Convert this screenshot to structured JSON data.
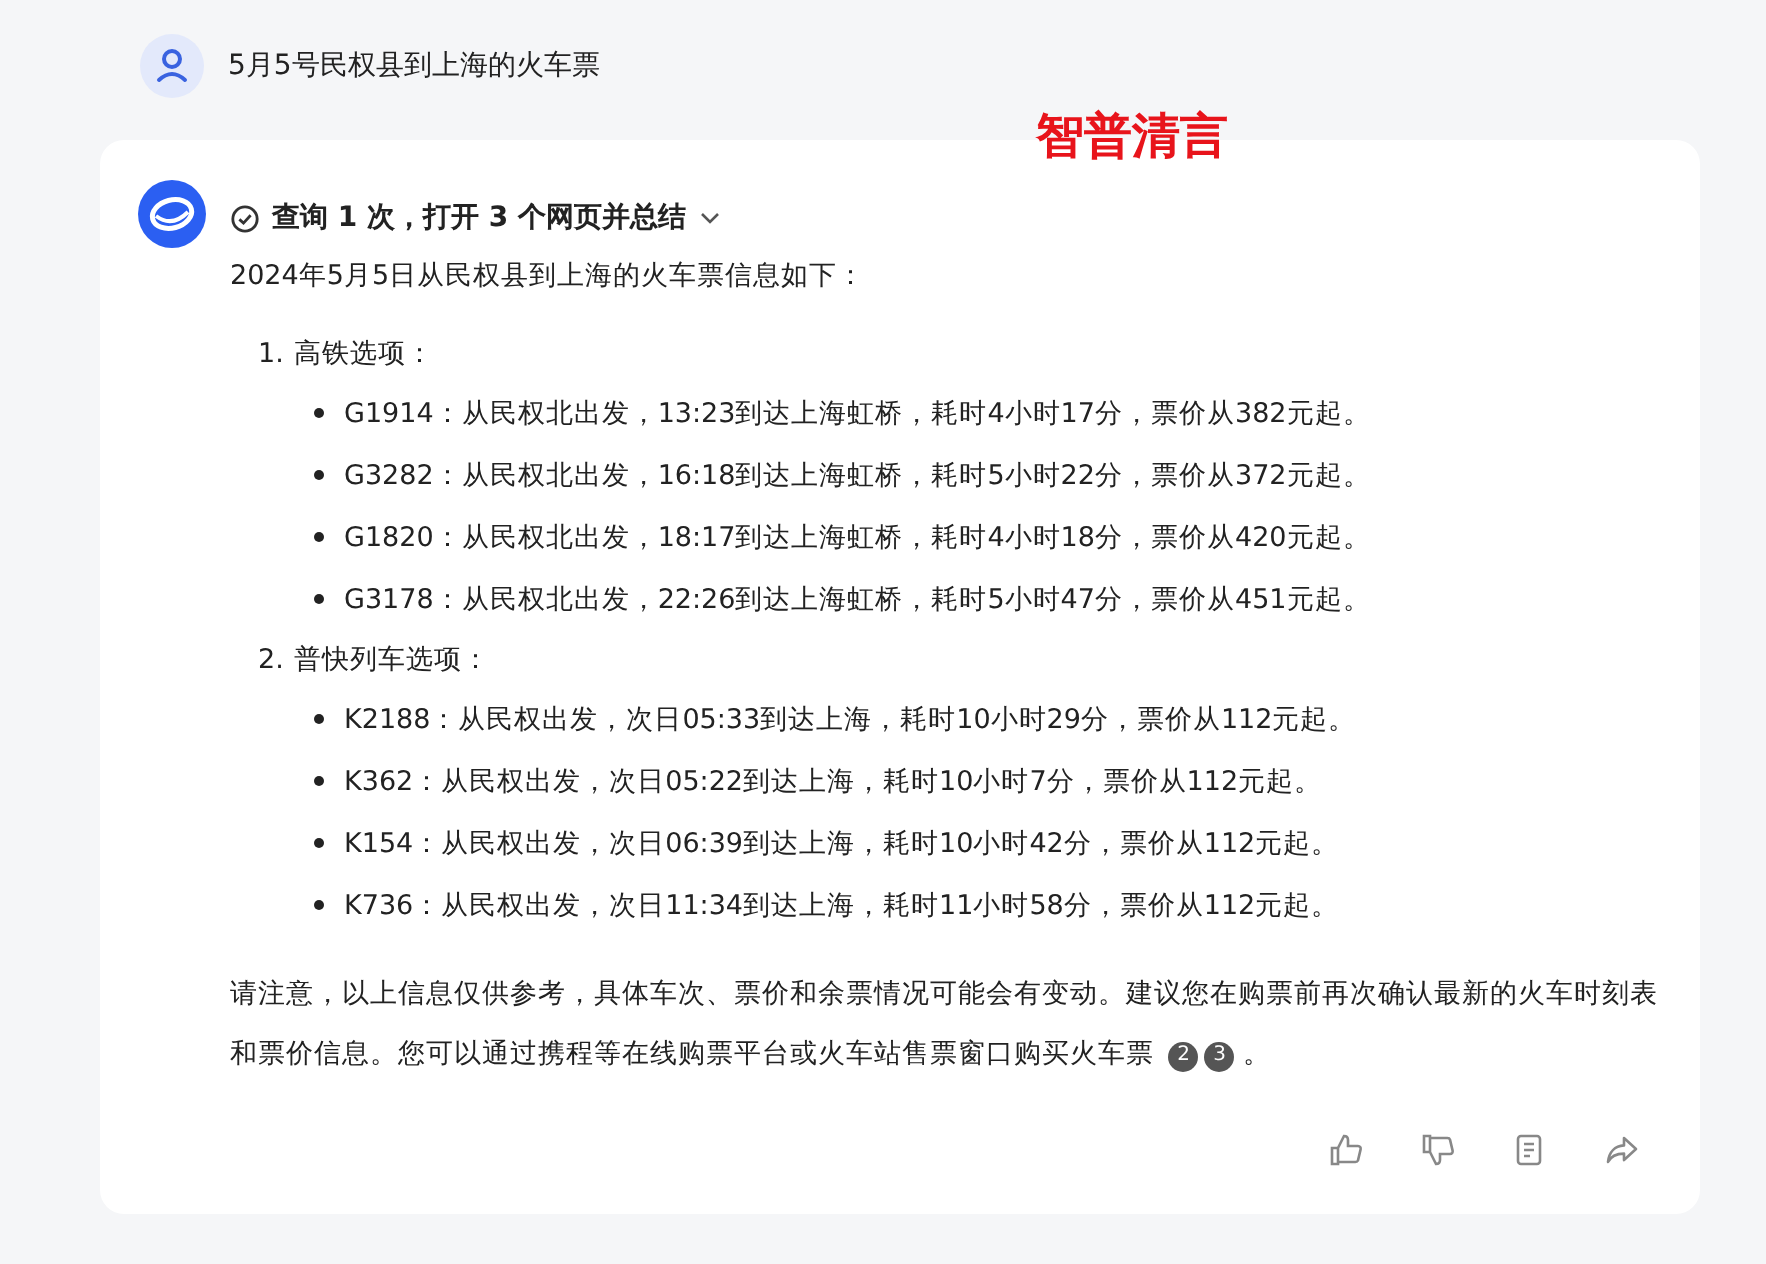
{
  "user_message": {
    "text": "5月5号民权县到上海的火车票"
  },
  "overlay_label": "智普清言",
  "answer": {
    "search_summary": {
      "text": "查询 1 次，打开 3 个网页并总结",
      "expanded": false
    },
    "intro": "2024年5月5日从民权县到上海的火车票信息如下：",
    "sections": [
      {
        "number": "1.",
        "title": "高铁选项：",
        "items": [
          "G1914：从民权北出发，13:23到达上海虹桥，耗时4小时17分，票价从382元起。",
          "G3282：从民权北出发，16:18到达上海虹桥，耗时5小时22分，票价从372元起。",
          "G1820：从民权北出发，18:17到达上海虹桥，耗时4小时18分，票价从420元起。",
          "G3178：从民权北出发，22:26到达上海虹桥，耗时5小时47分，票价从451元起。"
        ]
      },
      {
        "number": "2.",
        "title": "普快列车选项：",
        "items": [
          "K2188：从民权出发，次日05:33到达上海，耗时10小时29分，票价从112元起。",
          "K362：从民权出发，次日05:22到达上海，耗时10小时7分，票价从112元起。",
          "K154：从民权出发，次日06:39到达上海，耗时10小时42分，票价从112元起。",
          "K736：从民权出发，次日11:34到达上海，耗时11小时58分，票价从112元起。"
        ]
      }
    ],
    "note": "请注意，以上信息仅供参考，具体车次、票价和余票情况可能会有变动。建议您在购票前再次确认最新的火车时刻表和票价信息。您可以通过携程等在线购票平台或火车站售票窗口购买火车票",
    "citations": [
      "2",
      "3"
    ],
    "note_end": "。"
  }
}
